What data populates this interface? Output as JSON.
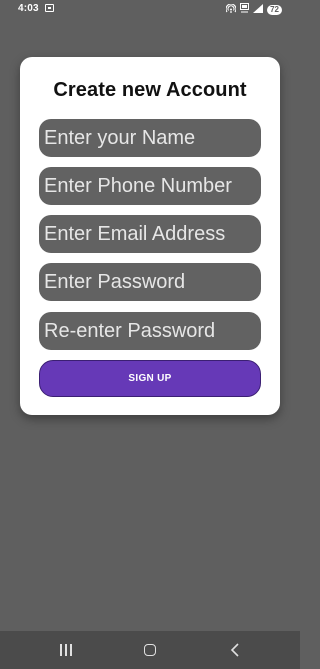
{
  "status_bar": {
    "time": "4:03",
    "battery": "72"
  },
  "form": {
    "title": "Create new Account",
    "fields": [
      {
        "placeholder": "Enter your Name",
        "value": ""
      },
      {
        "placeholder": "Enter Phone Number",
        "value": ""
      },
      {
        "placeholder": "Enter Email Address",
        "value": ""
      },
      {
        "placeholder": "Enter Password",
        "value": ""
      },
      {
        "placeholder": "Re-enter Password",
        "value": ""
      }
    ],
    "signup_label": "SIGN UP"
  },
  "colors": {
    "background": "#5f5f5f",
    "card": "#ffffff",
    "field": "#626262",
    "accent": "#6639b7"
  },
  "icons": {
    "status_left": "screenshot-icon",
    "status_right": [
      "hotspot-icon",
      "volte-icon",
      "signal-icon",
      "battery-icon"
    ],
    "nav": [
      "recents-icon",
      "home-icon",
      "back-icon"
    ]
  }
}
